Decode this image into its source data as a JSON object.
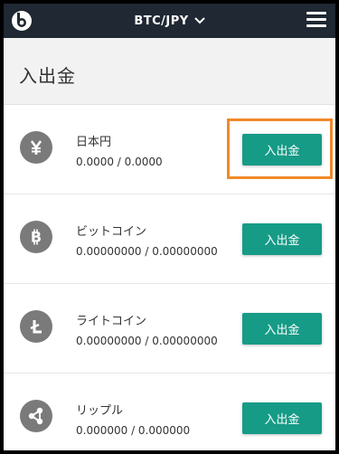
{
  "header": {
    "pair": "BTC/JPY",
    "logo_icon": "bitbank-logo-icon",
    "menu_icon": "hamburger-menu-icon"
  },
  "page": {
    "title": "入出金"
  },
  "accounts": [
    {
      "icon": "yen-icon",
      "name": "日本円",
      "balance": "0.0000 / 0.0000",
      "button": "入出金"
    },
    {
      "icon": "bitcoin-icon",
      "name": "ビットコイン",
      "balance": "0.00000000 / 0.00000000",
      "button": "入出金"
    },
    {
      "icon": "litecoin-icon",
      "name": "ライトコイン",
      "balance": "0.00000000 / 0.00000000",
      "button": "入出金"
    },
    {
      "icon": "ripple-icon",
      "name": "リップル",
      "balance": "0.000000 / 0.000000",
      "button": "入出金"
    }
  ],
  "colors": {
    "topbar": "#1f2833",
    "button": "#169b87",
    "highlight": "#f0892a",
    "coin_icon": "#7a7a7a"
  }
}
